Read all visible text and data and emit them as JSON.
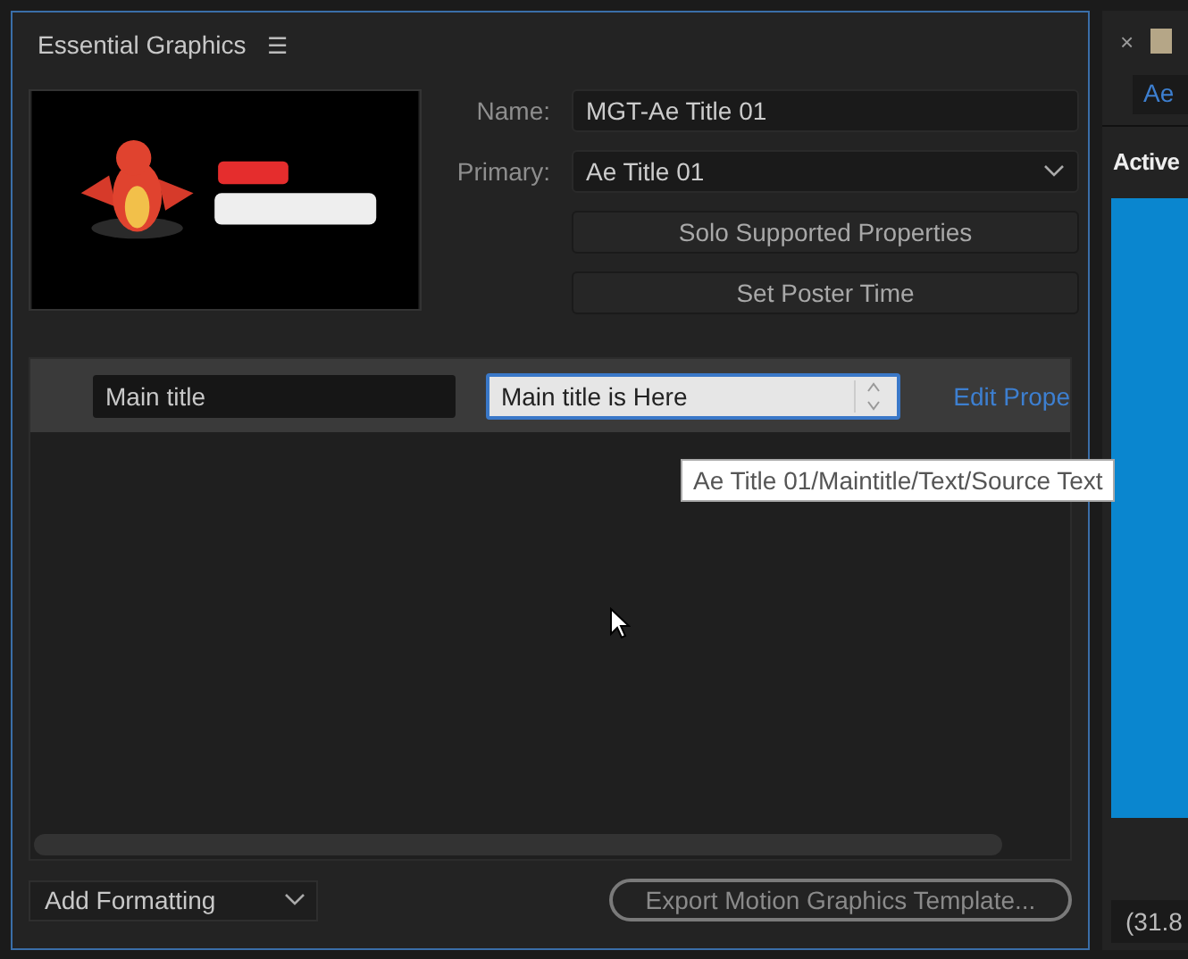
{
  "panel": {
    "title": "Essential Graphics",
    "menu_icon": "☰",
    "fields": [
      {
        "label": "Name:",
        "value": "MGT-Ae Title 01",
        "kind": "text"
      },
      {
        "label": "Primary:",
        "value": "Ae Title 01",
        "kind": "dropdown"
      }
    ],
    "buttons": [
      "Solo Supported Properties",
      "Set Poster Time"
    ],
    "properties": [
      {
        "name": "Main title",
        "value": "Main title is Here",
        "focused": true,
        "link": "Edit Prope"
      }
    ],
    "tooltip": "Ae Title 01/Maintitle/Text/Source Text",
    "add_formatting": "Add Formatting",
    "export_button": "Export Motion Graphics Template..."
  },
  "side_panel": {
    "close": "×",
    "tab": "Ae",
    "heading": "Active",
    "field_value": "(31.8"
  }
}
